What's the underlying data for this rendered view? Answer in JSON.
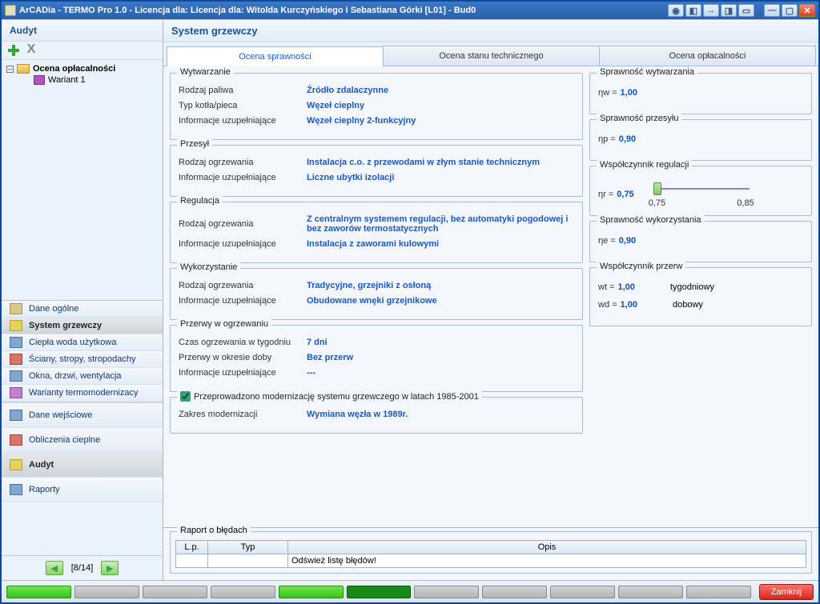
{
  "title": "ArCADia - TERMO Pro 1.0 - Licencja dla: Licencja dla: Witolda Kurczyńskiego i Sebastiana Górki [L01] - Bud0",
  "sidebar": {
    "header": "Audyt",
    "tree": {
      "root": "Ocena opłacalności",
      "child": "Wariant 1"
    },
    "nav1": [
      {
        "label": "Dane ogólne"
      },
      {
        "label": "System grzewczy"
      },
      {
        "label": "Ciepła woda użytkowa"
      },
      {
        "label": "Ściany, stropy, stropodachy"
      },
      {
        "label": "Okna, drzwi, wentylacja"
      },
      {
        "label": "Warianty termomodernizacy"
      }
    ],
    "nav2": [
      {
        "label": "Dane wejściowe"
      },
      {
        "label": "Obliczenia cieplne"
      },
      {
        "label": "Audyt"
      },
      {
        "label": "Raporty"
      }
    ],
    "pager": "[8/14]"
  },
  "main": {
    "header": "System grzewczy",
    "tabs": [
      "Ocena sprawności",
      "Ocena stanu technicznego",
      "Ocena opłacalności"
    ],
    "wytwarzanie": {
      "legend": "Wytwarzanie",
      "rodzaj_paliwa_k": "Rodzaj paliwa",
      "rodzaj_paliwa_v": "Źródło zdalaczynne",
      "typ_kotla_k": "Typ kotła/pieca",
      "typ_kotla_v": "Węzeł cieplny",
      "info_k": "Informacje uzupełniające",
      "info_v": "Węzeł cieplny 2-funkcyjny"
    },
    "przesyl": {
      "legend": "Przesył",
      "rodzaj_k": "Rodzaj ogrzewania",
      "rodzaj_v": "Instalacja c.o. z przewodami w złym stanie technicznym",
      "info_k": "Informacje uzupełniające",
      "info_v": "Liczne ubytki izolacji"
    },
    "regulacja": {
      "legend": "Regulacja",
      "rodzaj_k": "Rodzaj ogrzewania",
      "rodzaj_v": "Z centralnym systemem regulacji, bez automatyki pogodowej i bez zaworów termostatycznych",
      "info_k": "Informacje uzupełniające",
      "info_v": "Instalacja z zaworami kulowymi"
    },
    "wykorzystanie": {
      "legend": "Wykorzystanie",
      "rodzaj_k": "Rodzaj ogrzewania",
      "rodzaj_v": "Tradycyjne, grzejniki z osłoną",
      "info_k": "Informacje uzupełniające",
      "info_v": "Obudowane wnęki grzejnikowe"
    },
    "przerwy": {
      "legend": "Przerwy w ogrzewaniu",
      "czas_k": "Czas ogrzewania w tygodniu",
      "czas_v": "7 dni",
      "doby_k": "Przerwy w okresie doby",
      "doby_v": "Bez przerw",
      "info_k": "Informacje uzupełniające",
      "info_v": "---"
    },
    "modern": {
      "legend": "Przeprowadzono modernizację systemu grzewczego w latach 1985-2001",
      "zakres_k": "Zakres modernizacji",
      "zakres_v": "Wymiana węzła w 1989r."
    },
    "side_wytw": {
      "legend": "Sprawność wytwarzania",
      "sym": "ηw =",
      "val": "1,00"
    },
    "side_przes": {
      "legend": "Sprawność przesyłu",
      "sym": "ηp =",
      "val": "0,90"
    },
    "side_reg": {
      "legend": "Współczynnik regulacji",
      "sym": "ηr =",
      "val": "0,75",
      "tick_lo": "0,75",
      "tick_hi": "0,85"
    },
    "side_wyk": {
      "legend": "Sprawność wykorzystania",
      "sym": "ηe =",
      "val": "0,90"
    },
    "side_przerw": {
      "legend": "Współczynnik przerw",
      "wt_sym": "wt =",
      "wt_val": "1,00",
      "wt_lbl": "tygodniowy",
      "wd_sym": "wd =",
      "wd_val": "1,00",
      "wd_lbl": "dobowy"
    },
    "report": {
      "legend": "Raport o błędach",
      "cols": {
        "lp": "L.p.",
        "typ": "Typ",
        "opis": "Opis"
      },
      "refresh": "Odśwież listę błędów!"
    }
  },
  "status": {
    "close": "Zamknij"
  }
}
